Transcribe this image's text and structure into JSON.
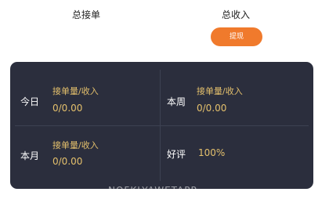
{
  "summary": {
    "total_orders_label": "总接单",
    "total_income_label": "总收入",
    "action_button_label": "提现"
  },
  "stats": {
    "today": {
      "label": "今日",
      "metric_label": "接单量/收入",
      "value": "0/0.00"
    },
    "this_week": {
      "label": "本周",
      "metric_label": "接单量/收入",
      "value": "0/0.00"
    },
    "this_month": {
      "label": "本月",
      "metric_label": "接单量/收入",
      "value": "0/0.00"
    },
    "rating": {
      "label": "好评",
      "value": "100%"
    }
  },
  "watermark": "NOFKLYAWETAPP",
  "colors": {
    "accent": "#f07a2c",
    "panel_bg": "#2b2e3d",
    "value_text": "#e4c06c"
  }
}
